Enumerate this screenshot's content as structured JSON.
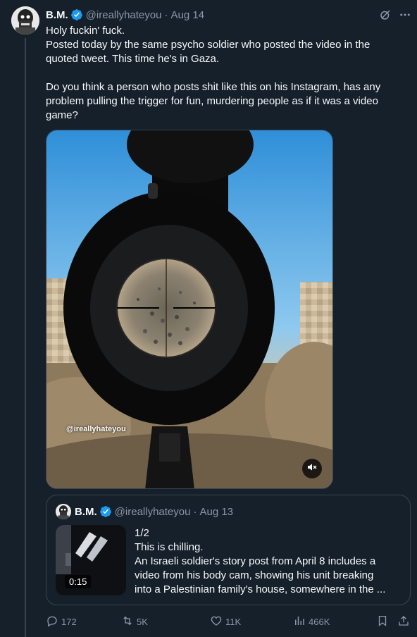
{
  "tweet": {
    "author_name": "B.M.",
    "handle": "@ireallyhateyou",
    "separator": "·",
    "date": "Aug 14",
    "text_lines": [
      "Holy fuckin' fuck.",
      "Posted today by the same psycho soldier who posted the video in the quoted tweet. This time he's in Gaza.",
      "Do you think a person who posts shit like this on his Instagram, has any problem pulling the trigger for fun, murdering people as if it was a video game?"
    ],
    "media": {
      "watermark": "@ireallyhateyou",
      "mute_icon": "muted-speaker-icon"
    }
  },
  "quote": {
    "author_name": "B.M.",
    "handle": "@ireallyhateyou",
    "separator": "·",
    "date": "Aug 13",
    "duration": "0:15",
    "text_lines": [
      "1/2",
      "This is chilling.",
      "An Israeli soldier's story post from April 8 includes a",
      "video from his body cam, showing his unit breaking",
      "into a Palestinian family's house, somewhere in the ..."
    ]
  },
  "actions": {
    "replies": "172",
    "reposts": "5K",
    "likes": "11K",
    "views": "466K"
  },
  "colors": {
    "background": "#15202b",
    "text": "#f7f9f9",
    "muted": "#8b98a5",
    "border": "#38444d",
    "verified": "#1d9bf0"
  }
}
